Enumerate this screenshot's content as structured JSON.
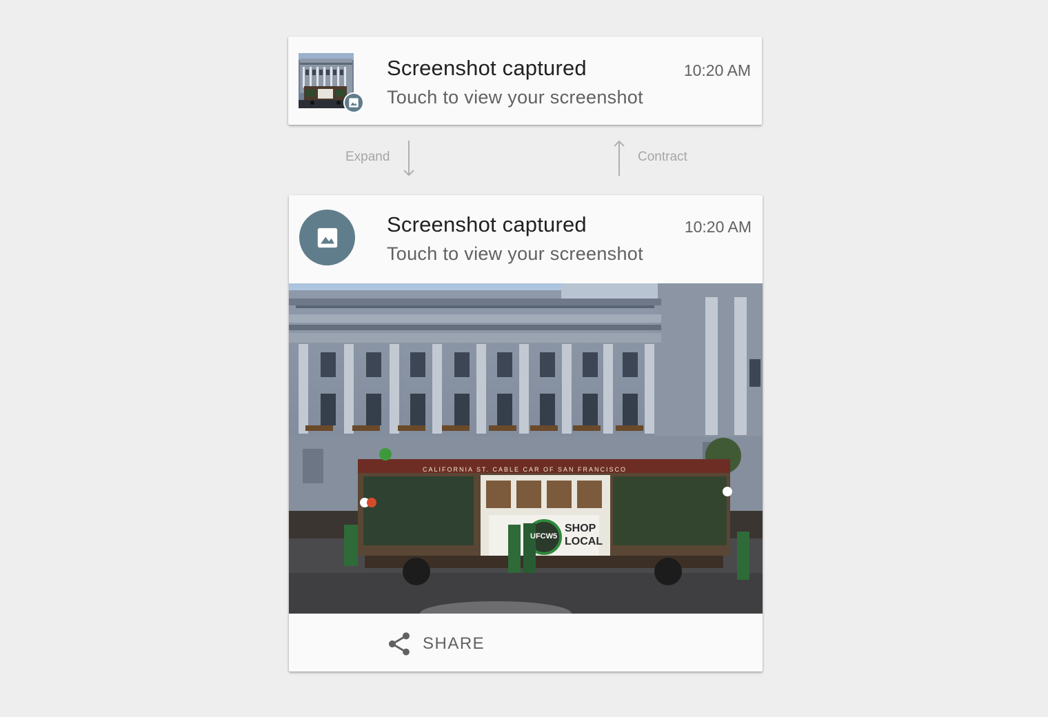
{
  "notification_collapsed": {
    "title": "Screenshot captured",
    "subtitle": "Touch to view your screenshot",
    "time": "10:20 AM",
    "thumbnail_icon": "screenshot-thumbnail",
    "badge_icon": "image-icon"
  },
  "transitions": {
    "expand_label": "Expand",
    "contract_label": "Contract"
  },
  "notification_expanded": {
    "title": "Screenshot captured",
    "subtitle": "Touch to view your screenshot",
    "time": "10:20 AM",
    "app_icon": "image-icon",
    "photo_signs": {
      "cable_car_banner": "CALIFORNIA ST. CABLE CAR OF SAN FRANCISCO",
      "shop_local": "SHOP LOCAL",
      "union_logo": "UFCW5"
    },
    "action": {
      "label": "SHARE",
      "icon": "share-icon"
    }
  },
  "colors": {
    "background": "#eeeeee",
    "card": "#fafafa",
    "icon_circle": "#607d8b",
    "title_text": "#212121",
    "secondary_text": "#616161",
    "hint_text": "#a6a6a6"
  }
}
